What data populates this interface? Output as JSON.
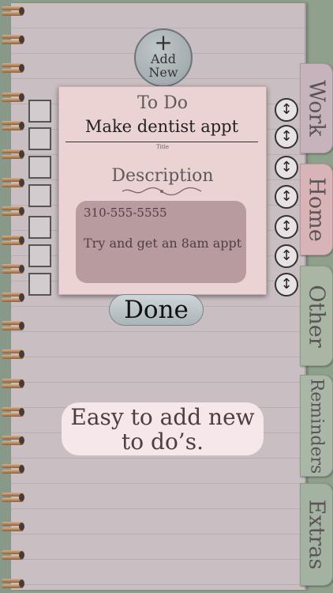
{
  "add_button": {
    "plus": "+",
    "label_line1": "Add",
    "label_line2": "New"
  },
  "tabs": {
    "work": "Work",
    "home": "Home",
    "other": "Other",
    "reminders": "Reminders",
    "extras": "Extras"
  },
  "tab_colors": {
    "work": "#c7b3bb",
    "home": "#d8b4b6",
    "other": "#a9b6a4",
    "reminders": "#aab6a6",
    "extras": "#a4b2a1"
  },
  "dialog": {
    "heading": "To Do",
    "title_value": "Make dentist appt",
    "title_caption": "Title",
    "description_heading": "Description",
    "description_line1": "310-555-5555",
    "description_line2": "Try and get an 8am appt"
  },
  "done_label": "Done",
  "caption": {
    "line1": "Easy to add new",
    "line2": "to do’s."
  },
  "reorder_glyph": "↕"
}
